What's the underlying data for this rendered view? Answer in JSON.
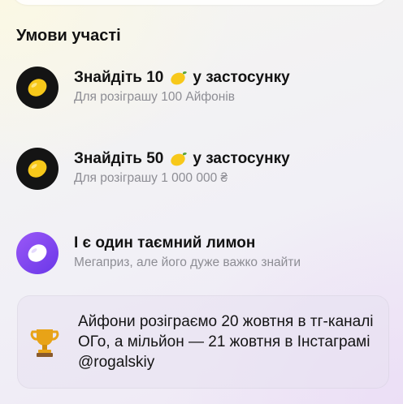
{
  "section": {
    "title": "Умови участі"
  },
  "conditions": [
    {
      "heading_before": "Знайдіть 10",
      "icon": "lemon-icon",
      "heading_after": "у застосунку",
      "subtitle": "Для розіграшу 100 Айфонів"
    },
    {
      "heading_before": "Знайдіть 50",
      "icon": "lemon-icon",
      "heading_after": "у застосунку",
      "subtitle": "Для розіграшу 1 000 000 ₴"
    },
    {
      "heading": "І є один таємний лимон",
      "icon": "secret-lemon-icon",
      "subtitle": "Мегаприз, але його дуже важко знайти"
    }
  ],
  "notice": {
    "icon": "trophy-icon",
    "text": "Айфони розіграємо 20 жовтня в тг-каналі ОГо, а мільйон — 21 жовтня в Інстаграмі @rogalskiy"
  },
  "colors": {
    "lemon": "#f7c81a",
    "badge_dark": "#141414",
    "badge_purple": "#7b44ee",
    "subtitle": "#8d8d94"
  }
}
